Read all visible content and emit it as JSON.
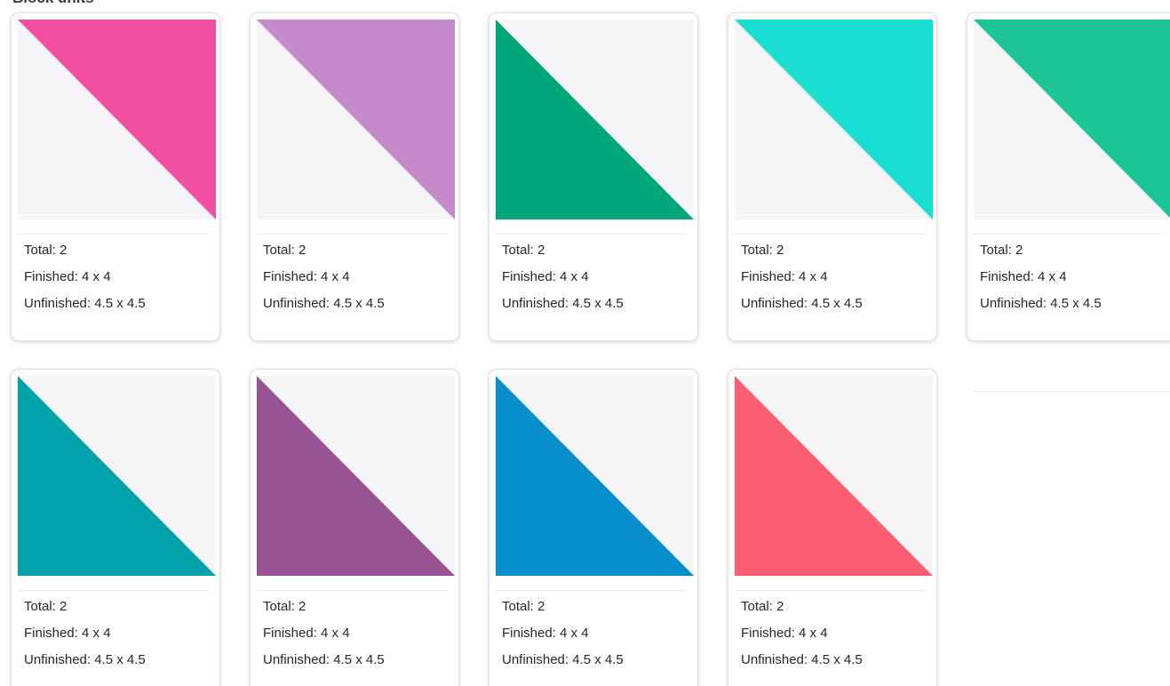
{
  "section": {
    "title": "Block units"
  },
  "units": [
    {
      "color": "#F24FA3",
      "triangle": "upper-right",
      "total": "Total: 2",
      "finished": "Finished: 4 x 4",
      "unfinished": "Unfinished: 4.5 x 4.5"
    },
    {
      "color": "#C58AC9",
      "triangle": "upper-right",
      "total": "Total: 2",
      "finished": "Finished: 4 x 4",
      "unfinished": "Unfinished: 4.5 x 4.5"
    },
    {
      "color": "#02A67B",
      "triangle": "lower-left",
      "total": "Total: 2",
      "finished": "Finished: 4 x 4",
      "unfinished": "Unfinished: 4.5 x 4.5"
    },
    {
      "color": "#1ADED1",
      "triangle": "upper-right",
      "total": "Total: 2",
      "finished": "Finished: 4 x 4",
      "unfinished": "Unfinished: 4.5 x 4.5"
    },
    {
      "color": "#1DC596",
      "triangle": "upper-right",
      "total": "Total: 2",
      "finished": "Finished: 4 x 4",
      "unfinished": "Unfinished: 4.5 x 4.5"
    },
    {
      "color": "#02A2AA",
      "triangle": "lower-left",
      "total": "Total: 2",
      "finished": "Finished: 4 x 4",
      "unfinished": "Unfinished: 4.5 x 4.5"
    },
    {
      "color": "#985394",
      "triangle": "lower-left",
      "total": "Total: 2",
      "finished": "Finished: 4 x 4",
      "unfinished": "Unfinished: 4.5 x 4.5"
    },
    {
      "color": "#078FCC",
      "triangle": "lower-left",
      "total": "Total: 2",
      "finished": "Finished: 4 x 4",
      "unfinished": "Unfinished: 4.5 x 4.5"
    },
    {
      "color": "#FB5E73",
      "triangle": "lower-left",
      "total": "Total: 2",
      "finished": "Finished: 4 x 4",
      "unfinished": "Unfinished: 4.5 x 4.5"
    }
  ],
  "swatch_background": "#F5F5F8"
}
